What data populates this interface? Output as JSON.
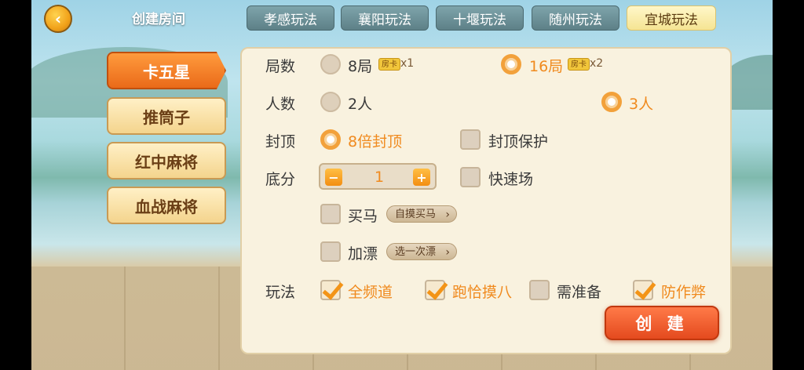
{
  "header": {
    "title": "创建房间"
  },
  "tabs": [
    {
      "label": "孝感玩法"
    },
    {
      "label": "襄阳玩法"
    },
    {
      "label": "十堰玩法"
    },
    {
      "label": "随州玩法"
    },
    {
      "label": "宜城玩法",
      "active": true
    }
  ],
  "sidebar": {
    "items": [
      {
        "label": "卡五星",
        "active": true
      },
      {
        "label": "推筒子"
      },
      {
        "label": "红中麻将"
      },
      {
        "label": "血战麻将"
      }
    ]
  },
  "rows": {
    "rounds": {
      "label": "局数",
      "opt1": "8局",
      "opt1_mult": "x1",
      "opt2": "16局",
      "opt2_mult": "x2",
      "badge": "房卡",
      "selected": "16局"
    },
    "players": {
      "label": "人数",
      "opt1": "2人",
      "opt2": "3人",
      "selected": "3人"
    },
    "cap": {
      "label": "封顶",
      "opt1": "8倍封顶",
      "opt2": "封顶保护",
      "opt1_selected": true,
      "opt2_checked": false
    },
    "base": {
      "label": "底分",
      "value": "1",
      "fast": "快速场",
      "fast_checked": false
    },
    "buyhorse": {
      "label": "买马",
      "pill": "自摸买马",
      "checked": false
    },
    "float": {
      "label": "加漂",
      "pill": "选一次漂",
      "checked": false
    },
    "play": {
      "label": "玩法",
      "options": [
        {
          "label": "全频道",
          "checked": true
        },
        {
          "label": "跑恰摸八",
          "checked": true
        },
        {
          "label": "需准备",
          "checked": false
        },
        {
          "label": "防作弊",
          "checked": true
        }
      ]
    }
  },
  "actions": {
    "create": "创 建"
  },
  "colors": {
    "accent": "#f08a1e",
    "primary": "#e44a1e"
  }
}
